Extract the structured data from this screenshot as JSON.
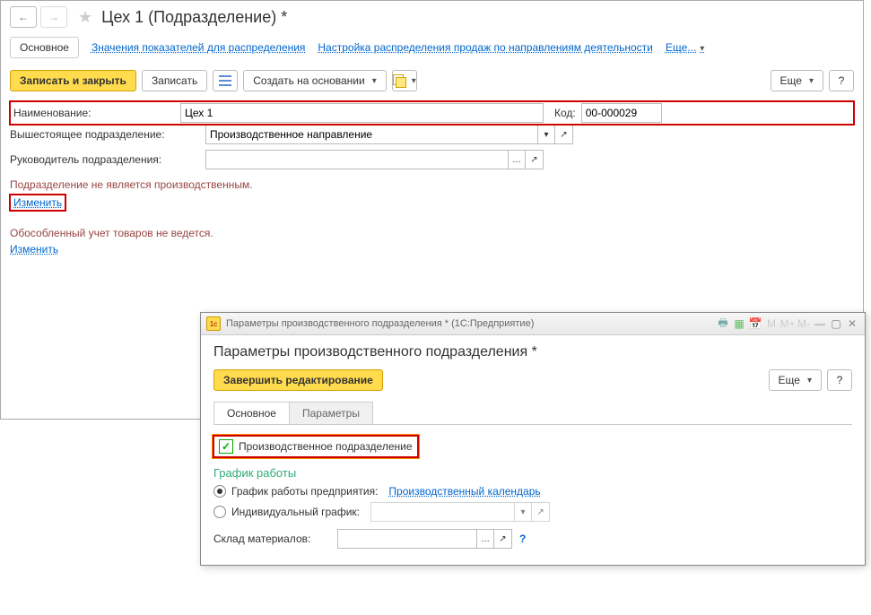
{
  "header": {
    "title": "Цех 1 (Подразделение) *"
  },
  "tabs": {
    "main": "Основное",
    "indicators": "Значения показателей для распределения",
    "sales": "Настройка распределения продаж по направлениям деятельности",
    "more": "Еще..."
  },
  "toolbar": {
    "save_close": "Записать и закрыть",
    "save": "Записать",
    "create_from": "Создать на основании",
    "more": "Еще"
  },
  "form": {
    "name_label": "Наименование:",
    "name_value": "Цех 1",
    "code_label": "Код:",
    "code_value": "00-000029",
    "parent_label": "Вышестоящее подразделение:",
    "parent_value": "Производственное направление",
    "manager_label": "Руководитель подразделения:",
    "manager_value": "",
    "not_production": "Подразделение не является производственным.",
    "change": "Изменить",
    "separate_accounting": "Обособленный учет товаров не ведется.",
    "change2": "Изменить"
  },
  "dialog": {
    "winTitle": "Параметры производственного подразделения * (1С:Предприятие)",
    "heading": "Параметры производственного подразделения *",
    "finish_edit": "Завершить редактирование",
    "more": "Еще",
    "tab_main": "Основное",
    "tab_params": "Параметры",
    "prod_checkbox": "Производственное подразделение",
    "schedule_section": "График работы",
    "radio_company": "График работы предприятия:",
    "calendar_link": "Производственный календарь",
    "radio_individual": "Индивидуальный график:",
    "materials_label": "Склад материалов:"
  }
}
